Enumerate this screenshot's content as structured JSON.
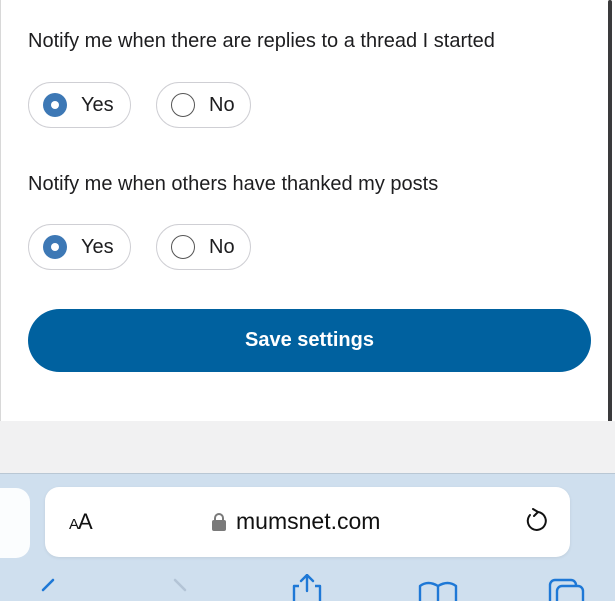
{
  "notifications": [
    {
      "question": "Notify me when there are replies to a thread I started",
      "options": [
        {
          "label": "Yes",
          "selected": true
        },
        {
          "label": "No",
          "selected": false
        }
      ]
    },
    {
      "question": "Notify me when others have thanked my posts",
      "options": [
        {
          "label": "Yes",
          "selected": true
        },
        {
          "label": "No",
          "selected": false
        }
      ]
    }
  ],
  "save_button_label": "Save settings",
  "browser": {
    "aa_large": "A",
    "aa_small": "A",
    "url": "mumsnet.com",
    "icons": [
      "lock-icon",
      "reload-icon",
      "back-icon",
      "forward-icon",
      "share-icon",
      "bookmarks-icon",
      "tabs-icon"
    ]
  },
  "colors": {
    "primary": "#00619f",
    "radio_selected": "#3d78b5",
    "toolbar": "#cfdfee"
  }
}
